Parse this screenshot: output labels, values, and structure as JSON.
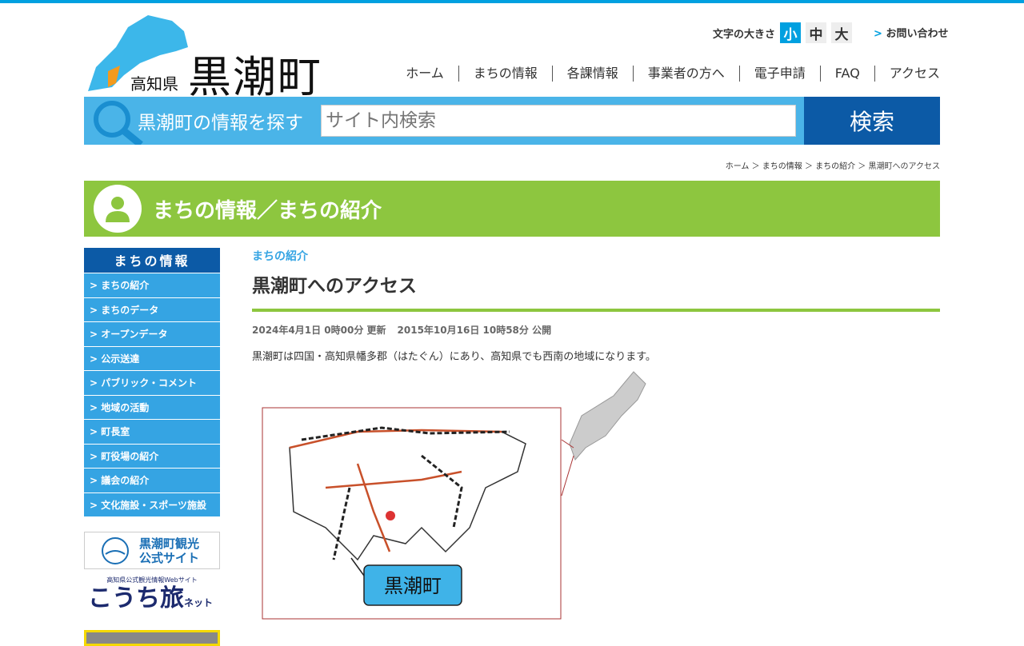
{
  "header": {
    "pref": "高知県",
    "town": "黒潮町",
    "font_size_label": "文字の大きさ",
    "font_sizes": [
      "小",
      "中",
      "大"
    ],
    "contact": "お問い合わせ"
  },
  "nav": [
    "ホーム",
    "まちの情報",
    "各課情報",
    "事業者の方へ",
    "電子申請",
    "FAQ",
    "アクセス"
  ],
  "search": {
    "label": "黒潮町の情報を探す",
    "placeholder": "サイト内検索",
    "button": "検索"
  },
  "breadcrumb": [
    "ホーム",
    "まちの情報",
    "まちの紹介",
    "黒潮町へのアクセス"
  ],
  "band_title": "まちの情報／まちの紹介",
  "sidebar": {
    "title": "まちの情報",
    "items": [
      "> まちの紹介",
      "> まちのデータ",
      "> オープンデータ",
      "> 公示送達",
      "> パブリック・コメント",
      "> 地域の活動",
      "> 町長室",
      "> 町役場の紹介",
      "> 議会の紹介",
      "> 文化施設・スポーツ施設"
    ]
  },
  "banners": {
    "tourism": "黒潮町観光公式サイト",
    "tourism_l1": "黒潮町観光",
    "tourism_l2": "公式サイト",
    "kochi_sub": "高知県公式観光情報Webサイト",
    "kochi_main": "こうち旅",
    "kochi_small": "ネット"
  },
  "article": {
    "category": "まちの紹介",
    "title": "黒潮町へのアクセス",
    "updated": "2024年4月1日 0時00分 更新",
    "published": "2015年10月16日 10時58分 公開",
    "body": "黒潮町は四国・高知県幡多郡（はたぐん）にあり、高知県でも西南の地域になります。",
    "map_label": "黒潮町"
  }
}
